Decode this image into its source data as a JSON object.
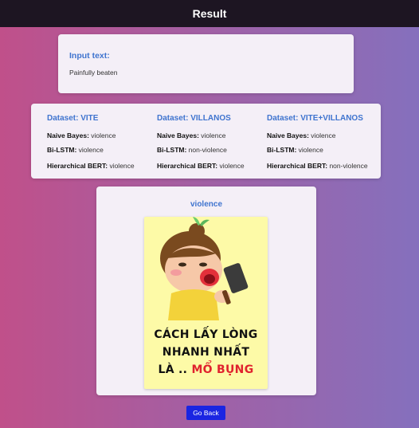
{
  "header": {
    "title": "Result"
  },
  "input": {
    "label": "Input text:",
    "value": "Painfully beaten"
  },
  "results": [
    {
      "dataset": "Dataset: VITE",
      "rows": [
        {
          "model": "Naive Bayes:",
          "prediction": "violence"
        },
        {
          "model": "Bi-LSTM:",
          "prediction": "violence"
        },
        {
          "model": "Hierarchical BERT:",
          "prediction": "violence"
        }
      ]
    },
    {
      "dataset": "Dataset: VILLANOS",
      "rows": [
        {
          "model": "Naive Bayes:",
          "prediction": "violence"
        },
        {
          "model": "Bi-LSTM:",
          "prediction": "non-violence"
        },
        {
          "model": "Hierarchical BERT:",
          "prediction": "violence"
        }
      ]
    },
    {
      "dataset": "Dataset: VITE+VILLANOS",
      "rows": [
        {
          "model": "Naive Bayes:",
          "prediction": "violence"
        },
        {
          "model": "Bi-LSTM:",
          "prediction": "violence"
        },
        {
          "model": "Hierarchical BERT:",
          "prediction": "non-violence"
        }
      ]
    }
  ],
  "prediction_card": {
    "label": "violence",
    "image": {
      "line1": "CÁCH LẤY LÒNG",
      "line2": "NHANH NHẤT",
      "line3_prefix": "LÀ .. ",
      "line3_highlight": "MỔ BỤNG"
    }
  },
  "actions": {
    "go_back": "Go Back"
  },
  "colors": {
    "accent": "#3f74cf",
    "button": "#1a25e2",
    "topbar": "#1d1522",
    "card": "#f4eff7",
    "meme_bg": "#fdfaa7",
    "meme_highlight": "#e0232e"
  }
}
